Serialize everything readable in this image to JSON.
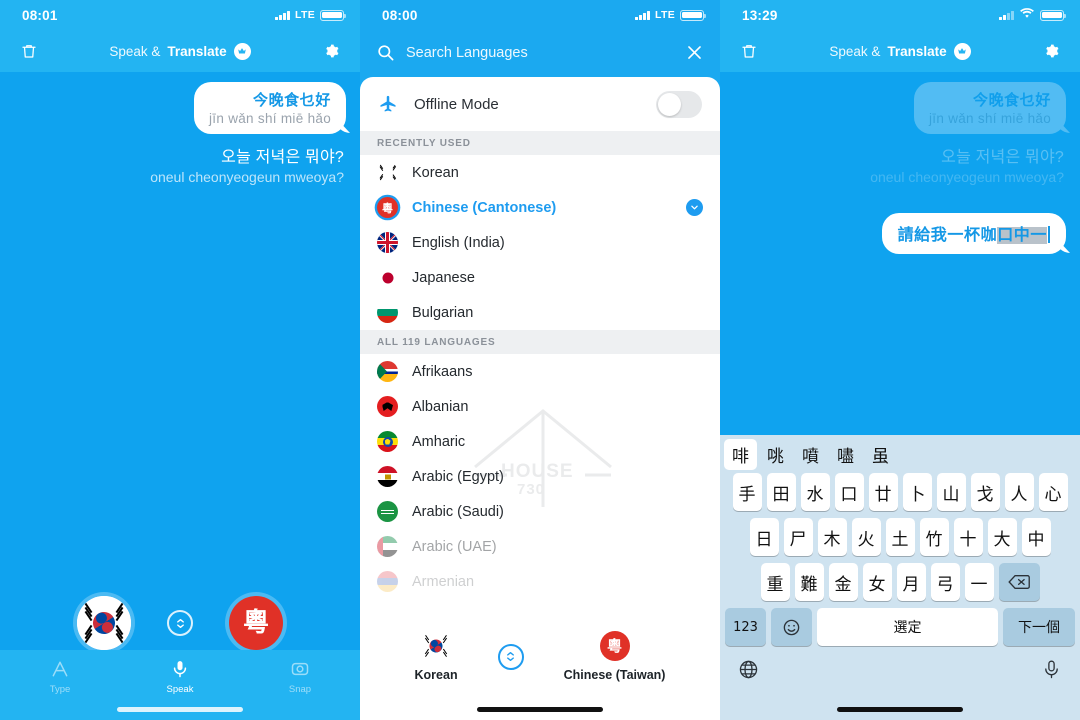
{
  "app": {
    "name_thin": "Speak &",
    "name_bold": "Translate"
  },
  "panel1": {
    "status": {
      "time": "08:01",
      "network": "LTE"
    },
    "header": {
      "trash_icon": "trash-icon",
      "settings_icon": "gear-icon",
      "pro_badge": "crown-icon"
    },
    "conversation": [
      {
        "type": "incoming_bubble",
        "text": "今晚食乜好",
        "romanization": "jīn wǎn shí miē hǎo"
      },
      {
        "type": "outgoing_plain",
        "text": "오늘 저녁은 뭐야?",
        "romanization": "oneul cheonyeogeun mweoya?"
      }
    ],
    "language_bar": {
      "source": {
        "label": "Korean",
        "flag": "kr-flag"
      },
      "target": {
        "label": "Chinese (Cantonese)",
        "flag": "cantonese-flag",
        "glyph": "粵"
      },
      "swap_icon": "swap-vertical-icon"
    },
    "tabs": [
      {
        "label": "Type",
        "icon": "type-icon",
        "active": false
      },
      {
        "label": "Speak",
        "icon": "microphone-icon",
        "active": true
      },
      {
        "label": "Snap",
        "icon": "camera-icon",
        "active": false
      }
    ]
  },
  "panel2": {
    "status": {
      "time": "08:00",
      "network": "LTE"
    },
    "search": {
      "placeholder": "Search Languages",
      "search_icon": "search-icon",
      "close_icon": "close-icon"
    },
    "offline": {
      "label": "Offline Mode",
      "icon": "airplane-icon",
      "enabled": false
    },
    "sections": [
      {
        "header": "RECENTLY USED",
        "items": [
          {
            "name": "Korean",
            "flag": "kr",
            "selected": false,
            "dimmed": false
          },
          {
            "name": "Chinese (Cantonese)",
            "flag": "cantonese",
            "selected": true,
            "dimmed": false,
            "chevron": "chevron-down-icon"
          },
          {
            "name": "English (India)",
            "flag": "uk",
            "selected": false,
            "dimmed": false
          },
          {
            "name": "Japanese",
            "flag": "jp",
            "selected": false,
            "dimmed": false
          },
          {
            "name": "Bulgarian",
            "flag": "bg",
            "selected": false,
            "dimmed": false
          }
        ]
      },
      {
        "header": "ALL 119 LANGUAGES",
        "items": [
          {
            "name": "Afrikaans",
            "flag": "za",
            "selected": false,
            "dimmed": false
          },
          {
            "name": "Albanian",
            "flag": "al",
            "selected": false,
            "dimmed": false
          },
          {
            "name": "Amharic",
            "flag": "et",
            "selected": false,
            "dimmed": false
          },
          {
            "name": "Arabic (Egypt)",
            "flag": "eg",
            "selected": false,
            "dimmed": false
          },
          {
            "name": "Arabic (Saudi)",
            "flag": "sa",
            "selected": false,
            "dimmed": false
          },
          {
            "name": "Arabic (UAE)",
            "flag": "ae",
            "selected": false,
            "dimmed": true
          },
          {
            "name": "Armenian",
            "flag": "am",
            "selected": false,
            "dimmed": true
          }
        ]
      }
    ],
    "language_bar": {
      "source": {
        "label": "Korean",
        "flag": "kr-flag"
      },
      "target": {
        "label": "Chinese (Taiwan)",
        "flag": "taiwan-flag",
        "glyph": "粵"
      },
      "swap_icon": "swap-vertical-icon"
    },
    "watermark": {
      "line1": "HOUSE",
      "line2": "730"
    }
  },
  "panel3": {
    "status": {
      "time": "13:29",
      "network": "wifi"
    },
    "header": {
      "trash_icon": "trash-icon",
      "settings_icon": "gear-icon",
      "pro_badge": "crown-icon"
    },
    "conversation": [
      {
        "type": "incoming_bubble_faded",
        "text": "今晚食乜好",
        "romanization": "jīn wǎn shí miē hǎo"
      },
      {
        "type": "outgoing_plain_faded",
        "text": "오늘 저녁은 뭐야?",
        "romanization": "oneul cheonyeogeun mweoya?"
      }
    ],
    "compose": {
      "text_plain": "請給我一杯咖",
      "text_selected": "口中一"
    },
    "keyboard": {
      "type": "cangjie",
      "candidates": [
        "啡",
        "咷",
        "噴",
        "嚍",
        "虽"
      ],
      "selected_candidate_index": 0,
      "rows": [
        [
          "手",
          "田",
          "水",
          "口",
          "廿",
          "卜",
          "山",
          "戈",
          "人",
          "心"
        ],
        [
          "日",
          "尸",
          "木",
          "火",
          "土",
          "竹",
          "十",
          "大",
          "中"
        ],
        [
          "重",
          "難",
          "金",
          "女",
          "月",
          "弓",
          "一"
        ]
      ],
      "delete_icon": "backspace-icon",
      "numbers_key": "123",
      "emoji_key": "emoji-icon",
      "space_key": "選定",
      "next_key": "下一個",
      "globe_icon": "globe-icon",
      "mic_icon": "microphone-icon"
    }
  },
  "colors": {
    "header_blue": "#23b4f2",
    "body_blue": "#0fa3ef",
    "accent_blue": "#1e9cf0",
    "bubble_text": "#1498e6",
    "flag_red": "#e03127",
    "keyboard_bg": "#cfe3f0",
    "key_dark": "#a9cbe0"
  }
}
